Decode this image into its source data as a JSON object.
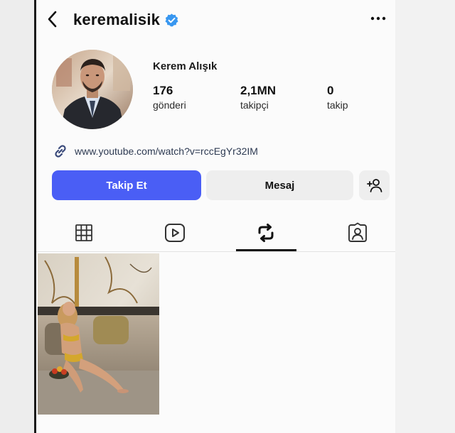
{
  "header": {
    "username": "keremalisik",
    "back_icon": "chevron-left-icon",
    "verified_icon": "verified-badge-icon",
    "verified_color": "#3897f0",
    "more_icon": "more-horizontal-icon"
  },
  "profile": {
    "display_name": "Kerem Alışık",
    "stats": [
      {
        "value": "176",
        "label": "gönderi"
      },
      {
        "value": "2,1MN",
        "label": "takipçi"
      },
      {
        "value": "0",
        "label": "takip"
      }
    ],
    "link": {
      "icon": "link-icon",
      "text": "www.youtube.com/watch?v=rccEgYr32IM"
    }
  },
  "actions": {
    "follow_label": "Takip Et",
    "follow_color": "#4a5ef5",
    "message_label": "Mesaj",
    "add_user_icon": "add-user-icon"
  },
  "tabs": [
    {
      "icon": "grid-icon"
    },
    {
      "icon": "reels-icon"
    },
    {
      "icon": "reposts-icon",
      "active": true
    },
    {
      "icon": "tagged-icon"
    }
  ],
  "posts": [
    {
      "type": "photo"
    }
  ]
}
